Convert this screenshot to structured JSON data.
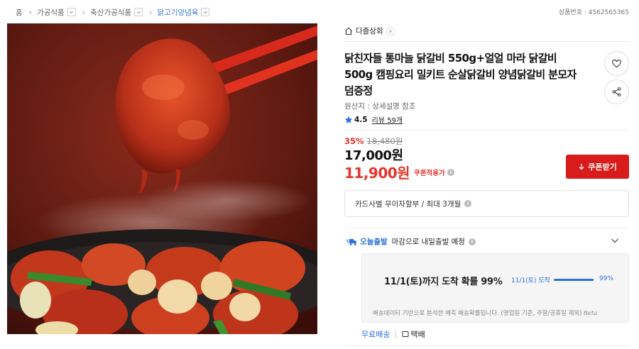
{
  "breadcrumb": {
    "items": [
      {
        "label": "홈"
      },
      {
        "label": "가공식품"
      },
      {
        "label": "축산가공식품"
      },
      {
        "label": "닭고기양념육"
      }
    ]
  },
  "product_no": "상품번호 : 4562565365",
  "store": {
    "name": "다즐상회",
    "icon": "store-icon"
  },
  "product": {
    "title": "닭친자들 통마늘 닭갈비 550g+얼얼 마라 닭갈비 500g 캠핑요리 밀키트 순살닭갈비 양념닭갈비 분모자 덤증정",
    "origin": "원산지 : 상세설명 참조",
    "rating": "4.5",
    "review_text": "리뷰 59개"
  },
  "price": {
    "discount_rate": "35%",
    "original_price": "18,480원",
    "sale_price": "17,000원",
    "coupon_price": "11,900원",
    "coupon_applied_label": "쿠폰적용가"
  },
  "coupon_button": {
    "label": "쿠폰받기"
  },
  "installment": {
    "text": "카드사별 무이자할부 / 최대 3개월"
  },
  "shipping": {
    "today_label": "오늘출발",
    "message": "마감으로 내일출발 예정",
    "eta_main": "11/1(토)까지 도착 확률 99%",
    "eta_date": "11/1(토) 도착",
    "eta_percent_label": "99%",
    "eta_percent": 99,
    "note": "배송데이터 기반으로 분석한 예측 배송확률입니다. (영업일 기준, 주말/공휴일 제외)",
    "beta": "Beta",
    "free_shipping": "무료배송",
    "parcel": "택배"
  },
  "colors": {
    "accent_red": "#e5352b",
    "coupon_button": "#d81b1b",
    "link_blue": "#2a6fdb"
  }
}
